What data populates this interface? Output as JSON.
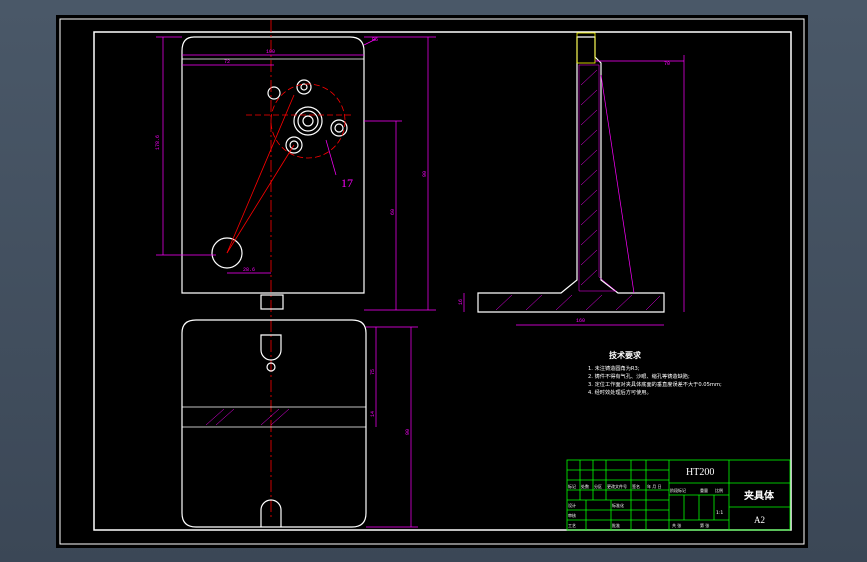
{
  "colors": {
    "background": "#000000",
    "frame": "#ffffff",
    "object": "#ffffff",
    "dimension": "#ff00ff",
    "hatch": "#ff00ff",
    "centerline": "#ff0000",
    "hidden": "#ffff00",
    "titleblock": "#00ff00",
    "text": "#ffffff"
  },
  "callouts": {
    "part_number": "17"
  },
  "dimensions": {
    "top_width": "100",
    "left_offset": "72",
    "height_main": "178.6",
    "right_height": "90",
    "inner_height": "60",
    "bottom_offset": "28.6",
    "side_width": "70",
    "side_base": "160",
    "side_base_thk": "16",
    "lower_h1": "75",
    "lower_h2": "90",
    "lower_small": "14",
    "radius_note": "R5"
  },
  "tech_requirements": {
    "title": "技术要求",
    "items": [
      "1. 未注铸造圆角为R3;",
      "2. 铸件不得有气孔、沙眼、缩孔等铸造缺陷;",
      "3. 定位工作面对夹具体底面的垂直度误差不大于0.05mm;",
      "4. 经时效处理后方可使用。"
    ]
  },
  "title_block": {
    "material": "HT200",
    "part_name": "夹具体",
    "sheet_size": "A2",
    "scale": "1:1",
    "labels": {
      "mark": "标记",
      "count": "处数",
      "zone": "分区",
      "change_doc": "更改文件号",
      "signature": "签名",
      "date": "年 月 日",
      "designer": "设计",
      "standardize": "标准化",
      "stage_mark": "阶段标记",
      "weight": "重量",
      "ratio": "比例",
      "review": "审核",
      "process": "工艺",
      "approve": "批准",
      "sheets_total": "共 张",
      "sheet_no": "第 张"
    }
  }
}
